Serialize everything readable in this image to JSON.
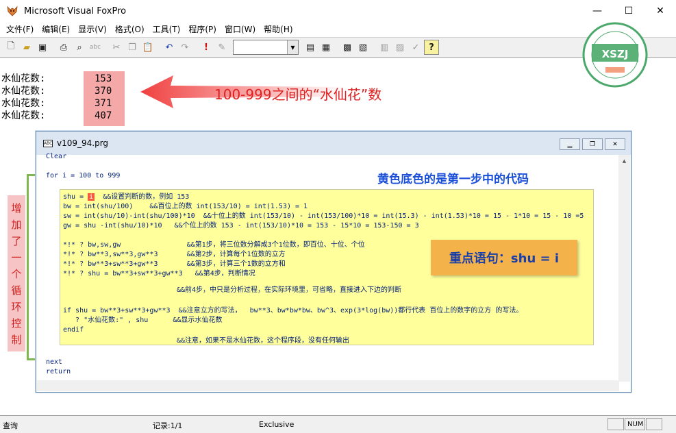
{
  "window": {
    "title": "Microsoft Visual FoxPro",
    "min": "—",
    "max": "☐",
    "close": "✕"
  },
  "menu": [
    "文件(F)",
    "编辑(E)",
    "显示(V)",
    "格式(O)",
    "工具(T)",
    "程序(P)",
    "窗口(W)",
    "帮助(H)"
  ],
  "output": {
    "label": "水仙花数:",
    "values": [
      "153",
      "370",
      "371",
      "407"
    ],
    "annotation": "100-999之间的“水仙花”数"
  },
  "side_label": [
    "增",
    "加",
    "了",
    "一",
    "个",
    "循",
    "环",
    "控",
    "制"
  ],
  "code_window": {
    "title": "v109_94.prg",
    "lines_top": [
      "Clear",
      "for i = 100 to 999"
    ],
    "yellow_lines": {
      "l1a": "shu = ",
      "l1b": "i",
      "l1c": "  &&设置判断的数，例如 153",
      "l2": "bw = int(shu/100)    &&百位上的数 int(153/10) = int(1.53) = 1",
      "l3": "sw = int(shu/10)-int(shu/100)*10  &&十位上的数 int(153/10) - int(153/100)*10 = int(15.3) - int(1.53)*10 = 15 - 1*10 = 15 - 10 =5",
      "l4": "gw = shu -int(shu/10)*10   &&个位上的数 153 - int(153/10)*10 = 153 - 15*10 = 153-150 = 3",
      "l5": "*!* ? bw,sw,gw                &&第1步，将三位数分解成3个1位数，即百位、十位、个位",
      "l6": "*!* ? bw**3,sw**3,gw**3       &&第2步，计算每个1位数的立方",
      "l7": "*!* ? bw**3+sw**3+gw**3       &&第3步，计算三个1数的立方和",
      "l8": "*!* ? shu = bw**3+sw**3+gw**3   &&第4步，判断情况",
      "l9": "&&前4步，中只是分析过程，在实际环境里，可省略，直接进入下边的判断",
      "l10": "if shu = bw**3+sw**3+gw**3  &&注意立方的写法，  bw**3、bw*bw*bw、bw^3、exp(3*log(bw))都行代表 百位上的数字的立方 的写法。",
      "l11": "   ? \"水仙花数:\" , shu      &&显示水仙花数",
      "l12": "endif",
      "l13": "&&注意，如果不是水仙花数，这个程序段，没有任何输出"
    },
    "lines_bottom": [
      "next",
      "return"
    ]
  },
  "annot_blue": "黄色底色的是第一步中的代码",
  "key_statement": "重点语句：shu = i",
  "statusbar": {
    "mode": "查询",
    "record": "记录:1/1",
    "exclusive": "Exclusive",
    "num": "NUM"
  },
  "colors": {
    "highlight": "#f25c3c",
    "yellow": "#ffff9c",
    "red_annot": "#e02020",
    "blue_annot": "#1a4fd8",
    "key_box": "#f4b24a"
  },
  "logo_text": "XSZJ"
}
